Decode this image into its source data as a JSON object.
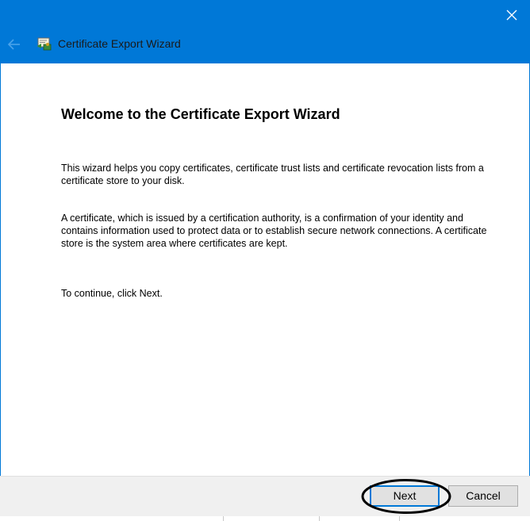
{
  "window": {
    "title": "Certificate Export Wizard",
    "accent_color": "#0078d7",
    "close_icon": "close-icon",
    "back_icon": "back-arrow-icon",
    "app_icon": "certificate-icon"
  },
  "content": {
    "heading": "Welcome to the Certificate Export Wizard",
    "paragraph1": "This wizard helps you copy certificates, certificate trust lists and certificate revocation lists from a certificate store to your disk.",
    "paragraph2": "A certificate, which is issued by a certification authority, is a confirmation of your identity and contains information used to protect data or to establish secure network connections. A certificate store is the system area where certificates are kept.",
    "paragraph3": "To continue, click Next."
  },
  "footer": {
    "next_label": "Next",
    "cancel_label": "Cancel",
    "highlight_color": "#000000"
  }
}
